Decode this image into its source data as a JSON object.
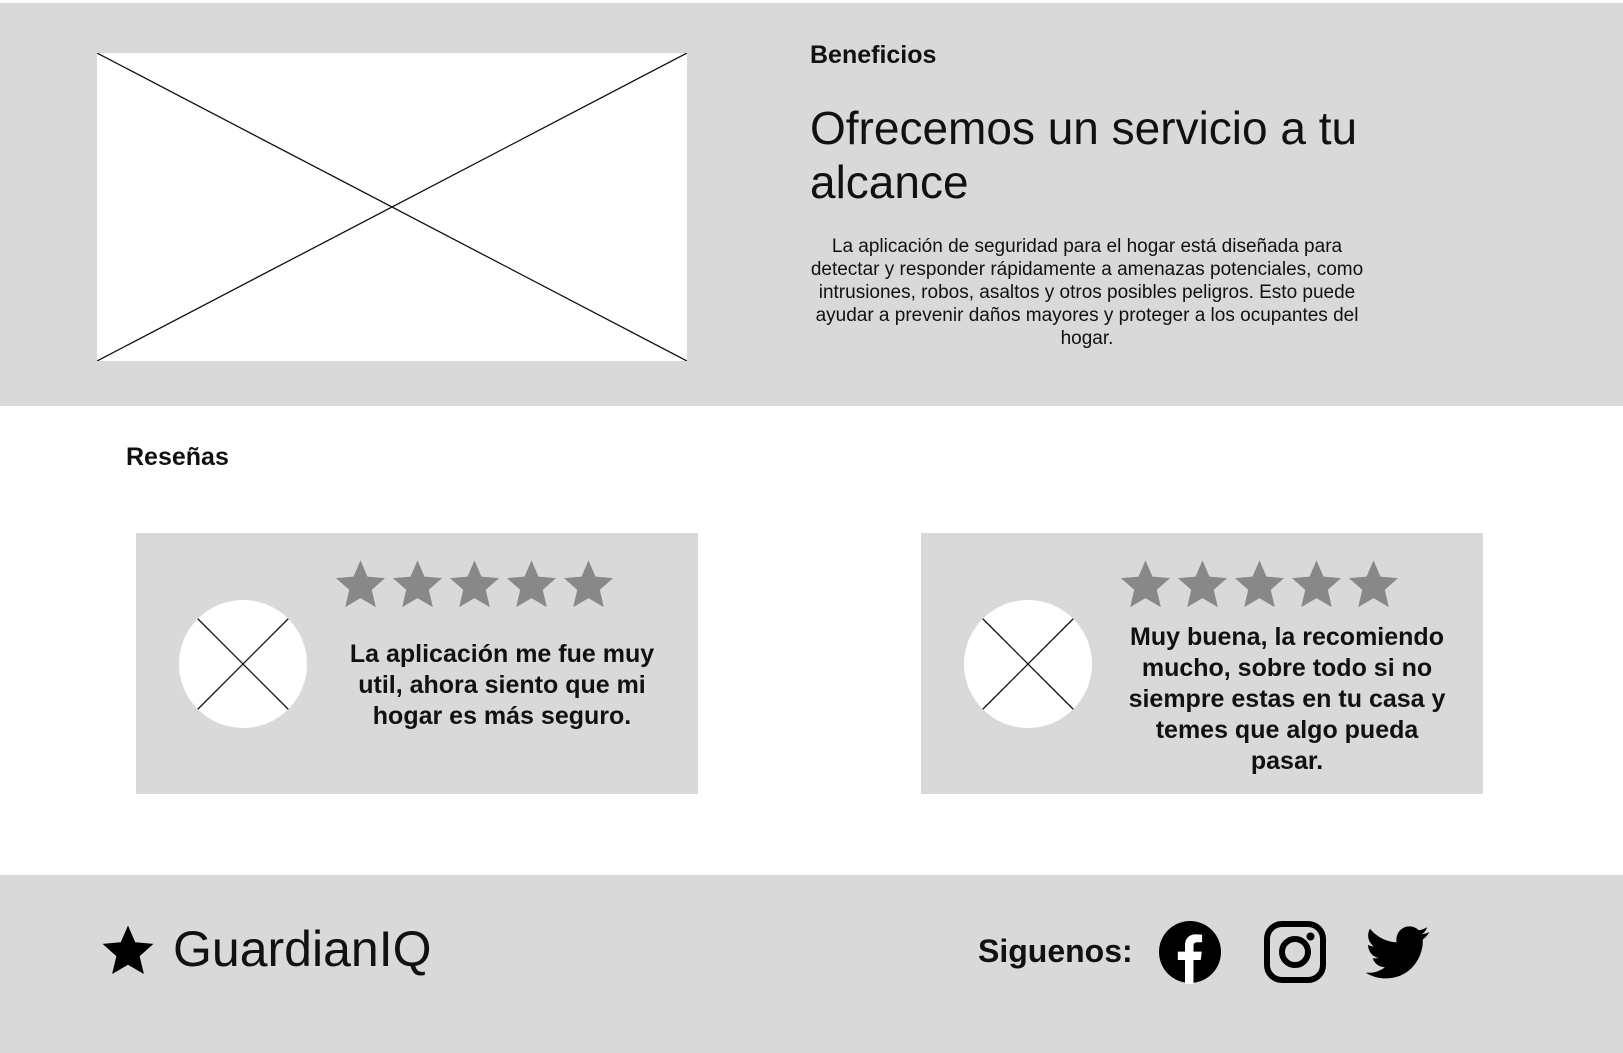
{
  "benefits": {
    "eyebrow": "Beneficios",
    "headline": "Ofrecemos un servicio a tu alcance",
    "description": "La aplicación de seguridad para el hogar está diseñada para detectar y responder rápidamente a amenazas potenciales, como intrusiones, robos, asaltos y otros posibles peligros. Esto puede ayudar a prevenir daños mayores y proteger a los ocupantes del hogar.",
    "image_icon": "image-placeholder-icon"
  },
  "reviews": {
    "title": "Reseñas",
    "items": [
      {
        "rating": 5,
        "max_rating": 5,
        "text": "La aplicación me fue muy util, ahora siento que mi hogar es más seguro.",
        "avatar_icon": "avatar-placeholder-icon"
      },
      {
        "rating": 5,
        "max_rating": 5,
        "text": "Muy buena, la recomiendo mucho, sobre todo si no siempre estas en tu casa y temes que algo pueda pasar.",
        "avatar_icon": "avatar-placeholder-icon"
      }
    ]
  },
  "footer": {
    "logo_icon": "star-icon",
    "brand": "GuardianIQ",
    "follow_label": "Siguenos:",
    "social": [
      {
        "name": "facebook-icon"
      },
      {
        "name": "instagram-icon"
      },
      {
        "name": "twitter-icon"
      }
    ]
  },
  "colors": {
    "section_bg": "#d9d9d9",
    "star": "#888888",
    "text": "#111111",
    "white": "#ffffff"
  }
}
